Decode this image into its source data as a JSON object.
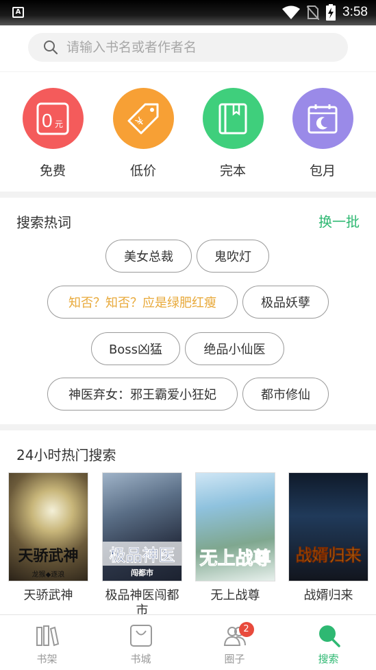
{
  "status_bar": {
    "app_badge": "A",
    "time": "3:58"
  },
  "search": {
    "placeholder": "请输入书名或者作者名"
  },
  "categories": [
    {
      "label": "免费",
      "icon": "free-icon",
      "color": "#f45b5b",
      "icon_text": "0",
      "icon_sub": "元"
    },
    {
      "label": "低价",
      "icon": "price-tag-icon",
      "color": "#f7a035",
      "icon_text": "¥"
    },
    {
      "label": "完本",
      "icon": "book-complete-icon",
      "color": "#3fcf7c"
    },
    {
      "label": "包月",
      "icon": "calendar-moon-icon",
      "color": "#9a8ae8"
    }
  ],
  "hot_words": {
    "title": "搜索热词",
    "refresh_label": "换一批",
    "highlight_color": "#e8a93a",
    "chips": [
      {
        "text": "美女总裁"
      },
      {
        "text": "鬼吹灯"
      },
      {
        "text": "知否？知否？应是绿肥红瘦"
      },
      {
        "text": "极品妖孽"
      },
      {
        "text": "Boss凶猛"
      },
      {
        "text": "绝品小仙医"
      },
      {
        "text": "神医弃女：邪王霸爱小狂妃"
      },
      {
        "text": "都市修仙"
      }
    ]
  },
  "hot_24h": {
    "title": "24小时热门搜索",
    "books": [
      {
        "title": "天骄武神",
        "cover_text": "天骄武神",
        "cover_sub": "龙猴◆逐浪"
      },
      {
        "title": "极品神医闯都市",
        "cover_text": "极品神医",
        "cover_sub": "闯都市"
      },
      {
        "title": "无上战尊",
        "cover_text": "无上战尊",
        "cover_sub": ""
      },
      {
        "title": "战婿归来",
        "cover_text": "战婿归来",
        "cover_sub": ""
      }
    ]
  },
  "bottom_nav": {
    "active_color": "#2eb872",
    "items": [
      {
        "label": "书架",
        "icon": "bookshelf-icon"
      },
      {
        "label": "书城",
        "icon": "bookstore-bag-icon"
      },
      {
        "label": "圈子",
        "icon": "community-icon",
        "badge": "2"
      },
      {
        "label": "搜索",
        "icon": "search-icon",
        "active": true
      }
    ]
  }
}
